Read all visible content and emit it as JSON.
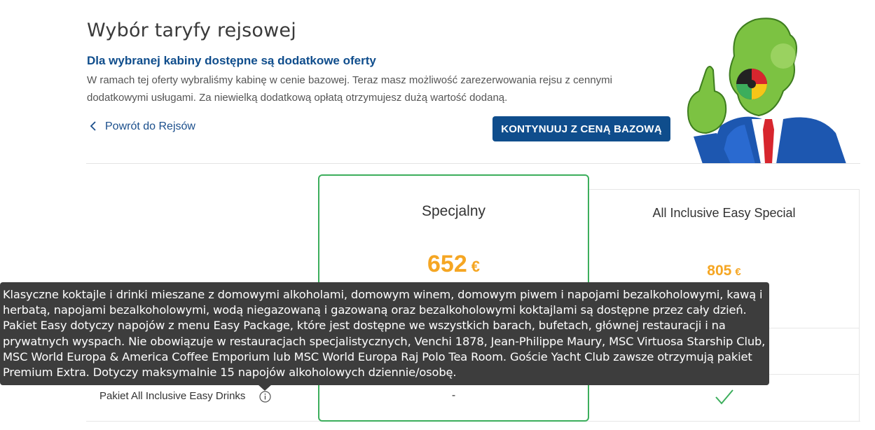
{
  "header": {
    "title": "Wybór taryfy rejsowej",
    "subtitle": "Dla wybranej kabiny dostępne są dodatkowe oferty",
    "description": "W ramach tej oferty wybraliśmy kabinę w cenie bazowej. Teraz masz możliwość zarezerwowania rejsu z cennymi dodatkowymi usługami. Za niewielką dodatkową opłatą otrzymujesz dużą wartość dodaną."
  },
  "actions": {
    "back_label": "Powrót do Rejsów",
    "continue_label": "KONTYNUUJ Z CENĄ BAZOWĄ"
  },
  "plans": [
    {
      "name": "Specjalny",
      "price": "652",
      "currency": "€",
      "selected": true
    },
    {
      "name": "All Inclusive Easy Special",
      "price": "805",
      "currency": "€",
      "selected": false
    }
  ],
  "features": [
    {
      "label": "Pakiet All Inclusive Easy Drinks",
      "values": [
        "-",
        "check-icon"
      ]
    }
  ],
  "tooltip": {
    "text": "Klasyczne koktajle i drinki mieszane z domowymi alkoholami, domowym winem, domowym piwem i napojami bezalkoholowymi, kawą i herbatą, napojami bezalkoholowymi, wodą niegazowaną i gazowaną oraz bezalkoholowymi koktajlami są dostępne przez cały dzień. Pakiet Easy dotyczy napojów z menu Easy Package, które jest dostępne we wszystkich barach, bufetach, głównej restauracji i na prywatnych wyspach. Nie obowiązuje w restauracjach specjalistycznych, Venchi 1878, Jean-Philippe Maury, MSC Virtuosa Starship Club, MSC World Europa & America Coffee Emporium lub MSC World Europa Raj Polo Tea Room. Goście Yacht Club zawsze otrzymują pakiet Premium Extra. Dotyczy maksymalnie 15 napojów alkoholowych dziennie/osobę."
  },
  "icons": {
    "back": "chevron-left-icon",
    "info": "info-icon",
    "included": "check-icon",
    "mascot": "mascot-illustration"
  },
  "colors": {
    "primary": "#0f4d8c",
    "price": "#f5a623",
    "selected_border": "#3cae5c",
    "tooltip_bg": "#3d3d3d"
  }
}
